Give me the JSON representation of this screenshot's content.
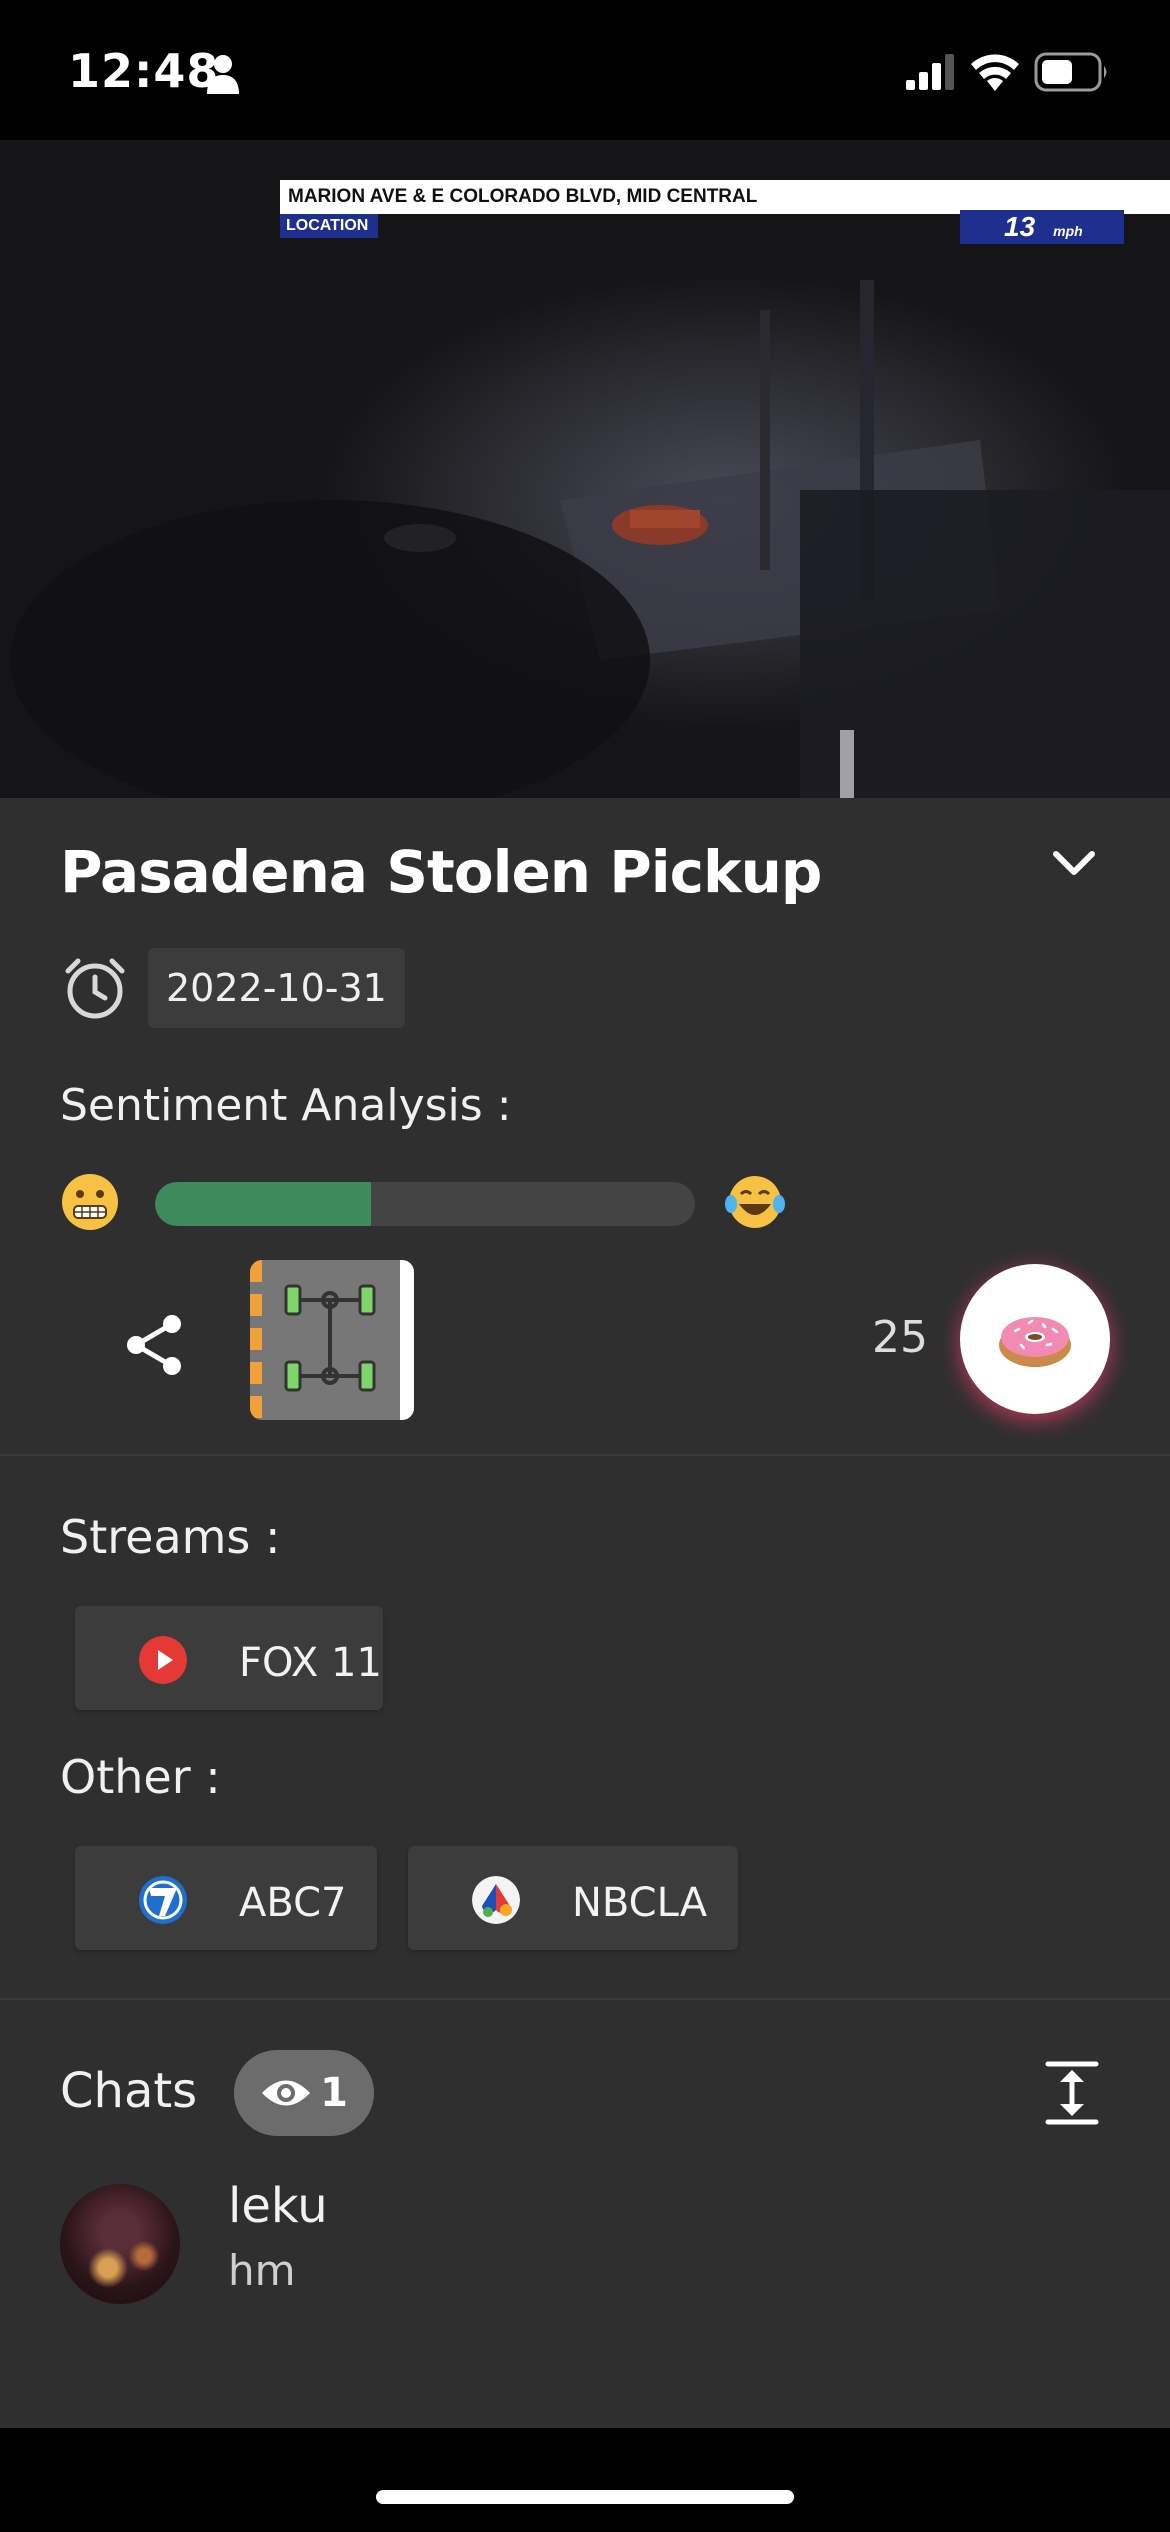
{
  "status_bar": {
    "time": "12:48",
    "icons": [
      "person-icon",
      "signal-icon",
      "wifi-icon",
      "battery-icon"
    ]
  },
  "video": {
    "ticker_text": "MARION AVE & E COLORADO BLVD, MID CENTRAL",
    "location_tag": "LOCATION",
    "speed_value": "13",
    "speed_unit": "mph"
  },
  "event": {
    "title": "Pasadena Stolen Pickup",
    "date": "2022-10-31",
    "sentiment_label": "Sentiment Analysis :",
    "sentiment_fraction": 0.4,
    "sentiment_left_emoji": "😬",
    "sentiment_right_emoji": "😂",
    "donut_count": "25",
    "donut_emoji": "🍩"
  },
  "streams": {
    "label": "Streams :",
    "items": [
      {
        "name": "FOX 11",
        "icon": "youtube-icon"
      }
    ]
  },
  "other": {
    "label": "Other :",
    "items": [
      {
        "name": "ABC7",
        "icon": "abc7-logo-icon"
      },
      {
        "name": "NBCLA",
        "icon": "nbc-logo-icon"
      }
    ]
  },
  "chats": {
    "label": "Chats",
    "viewer_count": "1",
    "messages": [
      {
        "user": "leku",
        "text": "hm"
      }
    ]
  },
  "colors": {
    "panel_bg": "#2f2f2f",
    "sentiment_fill": "#3e8a5c",
    "accent_red": "#e53935",
    "news_blue": "#1f2f8f"
  }
}
